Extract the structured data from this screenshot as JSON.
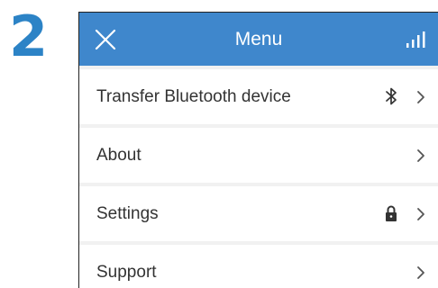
{
  "step": {
    "number": "2"
  },
  "header": {
    "title": "Menu",
    "close_icon": "close-icon",
    "signal_icon": "signal-bars-icon",
    "background_color": "#3f87cc"
  },
  "menu": {
    "items": [
      {
        "label": "Transfer Bluetooth device",
        "icon": "bluetooth-icon"
      },
      {
        "label": "About",
        "icon": null
      },
      {
        "label": "Settings",
        "icon": "lock-icon"
      },
      {
        "label": "Support",
        "icon": null
      }
    ]
  },
  "colors": {
    "accent": "#2c83c6",
    "header": "#3f87cc",
    "text": "#333333"
  }
}
